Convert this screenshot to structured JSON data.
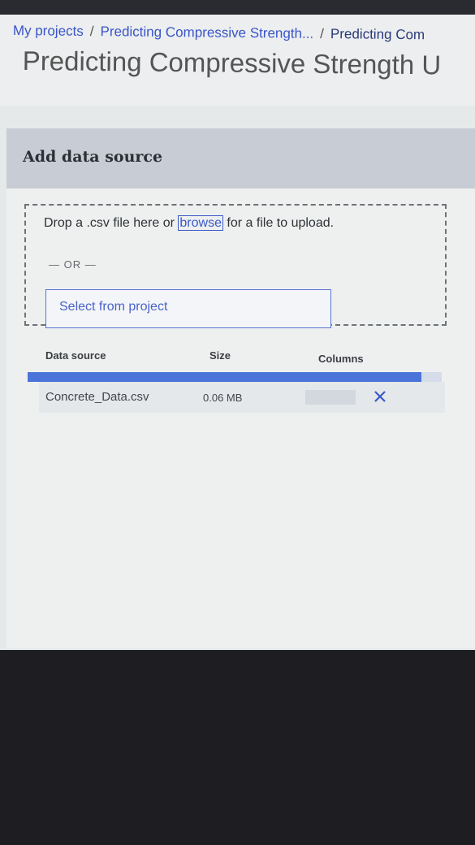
{
  "breadcrumb": {
    "items": [
      "My projects",
      "Predicting Compressive Strength...",
      "Predicting Com"
    ],
    "separator": "/"
  },
  "header": {
    "title": "Predicting Compressive Strength U"
  },
  "panel": {
    "title": "Add data source"
  },
  "dropzone": {
    "text_before": "Drop a .csv file here or ",
    "browse_label": "browse",
    "text_after": " for a file to upload.",
    "or_label": "— OR —",
    "select_button_label": "Select from project"
  },
  "table": {
    "headers": {
      "source": "Data source",
      "size": "Size",
      "columns": "Columns"
    },
    "upload_progress": 0.95,
    "rows": [
      {
        "name": "Concrete_Data.csv",
        "size": "0.06 MB",
        "columns": ""
      }
    ]
  },
  "icons": {
    "remove": "close-icon"
  },
  "colors": {
    "accent": "#3a58c8",
    "progress": "#4a74d9",
    "panel_header": "#c7ccd5"
  }
}
